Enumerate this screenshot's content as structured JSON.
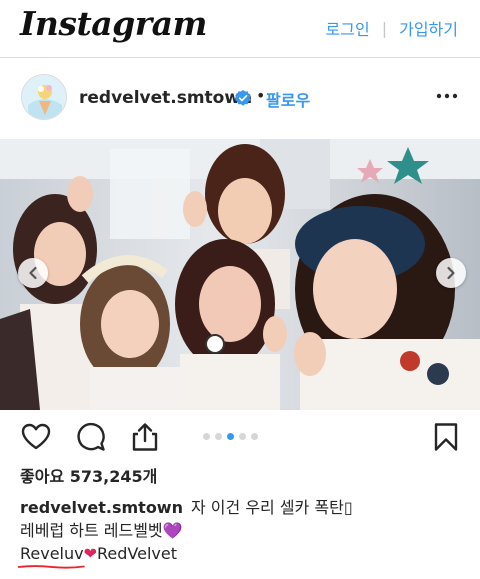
{
  "app": {
    "logo": "Instagram",
    "login_label": "로그인",
    "signup_label": "가입하기"
  },
  "post": {
    "username": "redvelvet.smtown",
    "follow_label": "팔로우",
    "separator": "•",
    "carousel": {
      "slide_count": 5,
      "active_index": 2
    },
    "likes_text": "좋아요 573,245개",
    "caption": {
      "username": "redvelvet.smtown",
      "line1": "자 이건 우리 셀카 폭탄",
      "line1_glyph": "▯",
      "line2": "레베럽 하트 레드벨벳",
      "line2_emoji": "💜",
      "line3_word": "Reveluv",
      "line3_emoji": "❤",
      "line3_tail": "RedVelvet"
    }
  },
  "colors": {
    "link_blue": "#3897f0",
    "verified_blue": "#3897f0",
    "annotation_red": "#e8262d",
    "heart_purple": "#9b3fd6",
    "heart_red": "#e0245e"
  },
  "icons": [
    "heart-icon",
    "comment-icon",
    "share-icon",
    "bookmark-icon",
    "more-options-icon",
    "chevron-left-icon",
    "chevron-right-icon",
    "verified-badge-icon"
  ]
}
